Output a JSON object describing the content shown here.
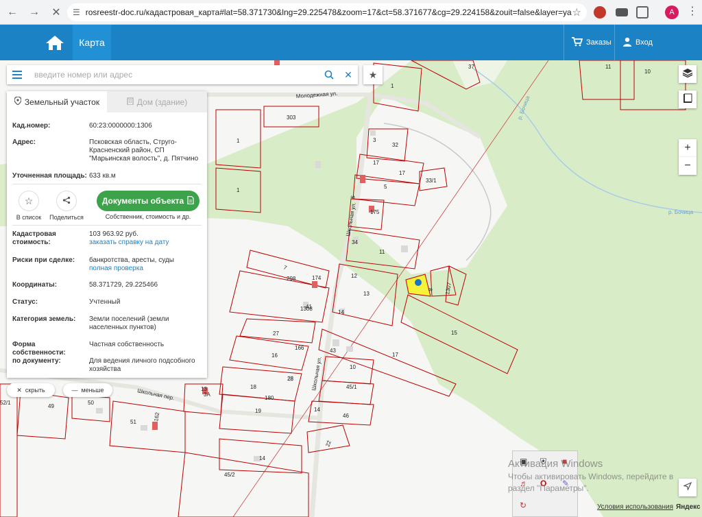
{
  "browser": {
    "url": "rosreestr-doc.ru/кадастровая_карта#lat=58.371730&lng=29.225478&zoom=17&ct=58.371677&cg=29.224158&zouit=false&layer=ya",
    "avatar_letter": "A"
  },
  "header": {
    "map_tab": "Карта",
    "orders": "Заказы",
    "login": "Вход"
  },
  "search": {
    "placeholder": "введите номер или адрес"
  },
  "panel": {
    "tabs": [
      {
        "label": "Земельный участок",
        "active": true
      },
      {
        "label": "Дом (здание)",
        "active": false
      }
    ],
    "cadnum_label": "Кад.номер:",
    "cadnum": "60:23:0000000:1306",
    "address_label": "Адрес:",
    "address": "Псковская область, Струго-Красненский район, СП \"Марьинская волость\", д. Пятчино",
    "area_label": "Уточненная площадь:",
    "area": "633 кв.м",
    "actions": {
      "to_list": "В список",
      "share": "Поделиться",
      "docs": "Документы объекта",
      "docs_sub": "Собственник, стоимость и др."
    },
    "cost_label": "Кадастровая стоимость:",
    "cost": "103 963.92 руб.",
    "cost_link": "заказать справку на дату",
    "risks_label": "Риски при сделке:",
    "risks": "банкротства, аресты, суды",
    "risks_link": "полная проверка",
    "coords_label": "Координаты:",
    "coords": "58.371729, 29.225466",
    "status_label": "Статус:",
    "status": "Учтенный",
    "category_label": "Категория земель:",
    "category": "Земли поселений (земли населенных пунктов)",
    "ownership_label": "Форма собственности:",
    "ownership": "Частная собственность",
    "bydoc_label": "по документу:",
    "bydoc": "Для ведения личного подсобного хозяйства"
  },
  "pills": {
    "hide": "скрыть",
    "less": "меньше"
  },
  "map": {
    "streets": [
      "Молодежная ул.",
      "Школьная ул.",
      "Школьная ул.",
      "Школьная пер.",
      "р. Бочица",
      "р. Бочица"
    ],
    "plots": [
      "37",
      "11",
      "10",
      "1",
      "303",
      "1",
      "1",
      "3",
      "32",
      "17",
      "5",
      "17",
      "33/1",
      "5",
      "175",
      "34",
      "11",
      "7",
      "298",
      "174",
      "12",
      "13",
      "8",
      "1307",
      "1308",
      "41",
      "14",
      "15",
      "27",
      "166",
      "16",
      "43",
      "17",
      "10",
      "28",
      "18",
      "45/1",
      "13",
      "3A",
      "180",
      "19",
      "46",
      "14",
      "49",
      "50",
      "51",
      "162",
      "14",
      "22",
      "45/2",
      "52/1",
      "2"
    ]
  },
  "watermark": {
    "line1": "Активация Windows",
    "line2": "Чтобы активировать Windows, перейдите в",
    "line3": "раздел \"Параметры\"."
  },
  "footer": {
    "terms": "Условия использования",
    "brand": "Яндекс"
  }
}
